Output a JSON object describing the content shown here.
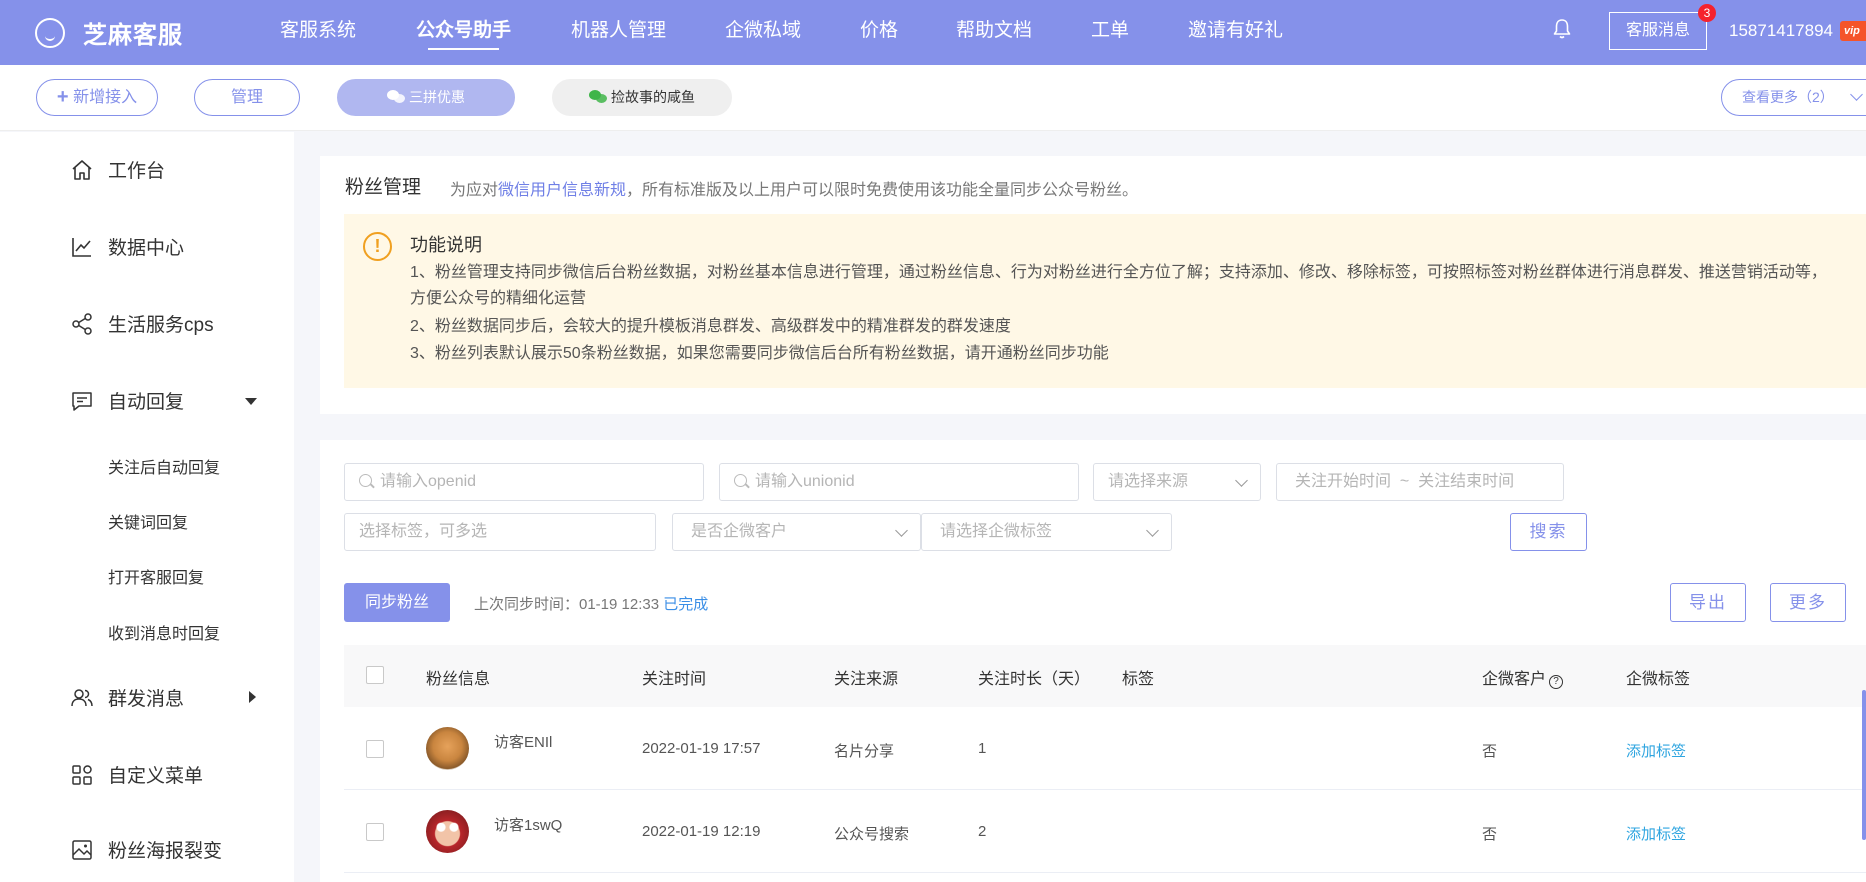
{
  "brand": {
    "name": "芝麻客服"
  },
  "nav": [
    {
      "label": "客服系统",
      "active": false
    },
    {
      "label": "公众号助手",
      "active": true
    },
    {
      "label": "机器人管理",
      "active": false
    },
    {
      "label": "企微私域",
      "active": false
    },
    {
      "label": "价格",
      "active": false
    },
    {
      "label": "帮助文档",
      "active": false
    },
    {
      "label": "工单",
      "active": false
    },
    {
      "label": "邀请有好礼",
      "active": false
    }
  ],
  "header": {
    "msg_label": "客服消息",
    "msg_badge": "3",
    "phone": "15871417894",
    "vip": "vip"
  },
  "accounts": {
    "add_label": "新增接入",
    "manage_label": "管理",
    "items": [
      {
        "label": "三拼优惠",
        "active": true
      },
      {
        "label": "捡故事的咸鱼",
        "active": false
      }
    ],
    "more_label": "查看更多（2）"
  },
  "sidebar": {
    "items": [
      {
        "label": "工作台",
        "icon": "home-icon"
      },
      {
        "label": "数据中心",
        "icon": "chart-icon"
      },
      {
        "label": "生活服务cps",
        "icon": "share-icon"
      },
      {
        "label": "自动回复",
        "icon": "message-icon"
      },
      {
        "label": "群发消息",
        "icon": "users-icon"
      },
      {
        "label": "自定义菜单",
        "icon": "grid-icon"
      },
      {
        "label": "粉丝海报裂变",
        "icon": "image-icon"
      }
    ],
    "subitems": [
      "关注后自动回复",
      "关键词回复",
      "打开客服回复",
      "收到消息时回复"
    ]
  },
  "page": {
    "title": "粉丝管理",
    "desc_prefix": "为应对",
    "desc_link": "微信用户信息新规",
    "desc_suffix": "，所有标准版及以上用户可以限时免费使用该功能全量同步公众号粉丝。"
  },
  "notice": {
    "title": "功能说明",
    "lines": [
      "1、粉丝管理支持同步微信后台粉丝数据，对粉丝基本信息进行管理，通过粉丝信息、行为对粉丝进行全方位了解；支持添加、修改、移除标签，可按照标签对粉丝群体进行消息群发、推送营销活动等，方便公众号的精细化运营",
      "2、粉丝数据同步后，会较大的提升模板消息群发、高级群发中的精准群发的群发速度",
      "3、粉丝列表默认展示50条粉丝数据，如果您需要同步微信后台所有粉丝数据，请开通粉丝同步功能"
    ]
  },
  "filters": {
    "openid_placeholder": "请输入openid",
    "unionid_placeholder": "请输入unionid",
    "source_placeholder": "请选择来源",
    "time_placeholder": "关注开始时间  ~  关注结束时间",
    "tag_placeholder": "选择标签，可多选",
    "wecom_placeholder": "是否企微客户",
    "wecom_tag_placeholder": "请选择企微标签",
    "search_label": "搜索"
  },
  "sync": {
    "button_label": "同步粉丝",
    "last_label": "上次同步时间：01-19 12:33",
    "status": "已完成",
    "export_label": "导出",
    "more_label": "更多"
  },
  "table": {
    "headers": [
      "粉丝信息",
      "关注时间",
      "关注来源",
      "关注时长（天）",
      "标签",
      "企微客户",
      "企微标签"
    ],
    "rows": [
      {
        "name": "访客ENIl",
        "time": "2022-01-19 17:57",
        "source": "名片分享",
        "days": "1",
        "tags": "",
        "wecom": "否",
        "wecom_tag": "添加标签"
      },
      {
        "name": "访客1swQ",
        "time": "2022-01-19 12:19",
        "source": "公众号搜索",
        "days": "2",
        "tags": "",
        "wecom": "否",
        "wecom_tag": "添加标签"
      }
    ]
  },
  "colors": {
    "primary": "#8591ea",
    "link": "#2fa5e0",
    "notice_bg": "#fff8e6",
    "warn": "#f0a020"
  }
}
